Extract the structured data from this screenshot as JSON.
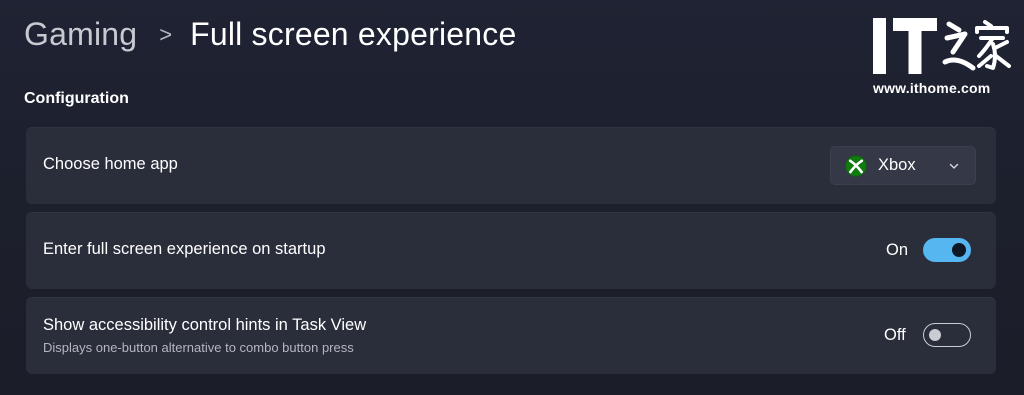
{
  "breadcrumb": {
    "parent": "Gaming",
    "separator": ">",
    "current": "Full screen experience"
  },
  "watermark": {
    "logo_text": "IT之家",
    "url": "www.ithome.com"
  },
  "section": {
    "title": "Configuration"
  },
  "settings": [
    {
      "label": "Choose home app",
      "control": "dropdown",
      "value": "Xbox",
      "icon": "xbox-icon"
    },
    {
      "label": "Enter full screen experience on startup",
      "control": "toggle",
      "state_label": "On",
      "checked": true
    },
    {
      "label": "Show accessibility control hints in Task View",
      "description": "Displays one-button alternative to combo button press",
      "control": "toggle",
      "state_label": "Off",
      "checked": false
    }
  ],
  "colors": {
    "accent": "#55b6f0",
    "card_background": "#2a2d3a",
    "page_background": "#1e2130",
    "xbox_green": "#107c10"
  }
}
